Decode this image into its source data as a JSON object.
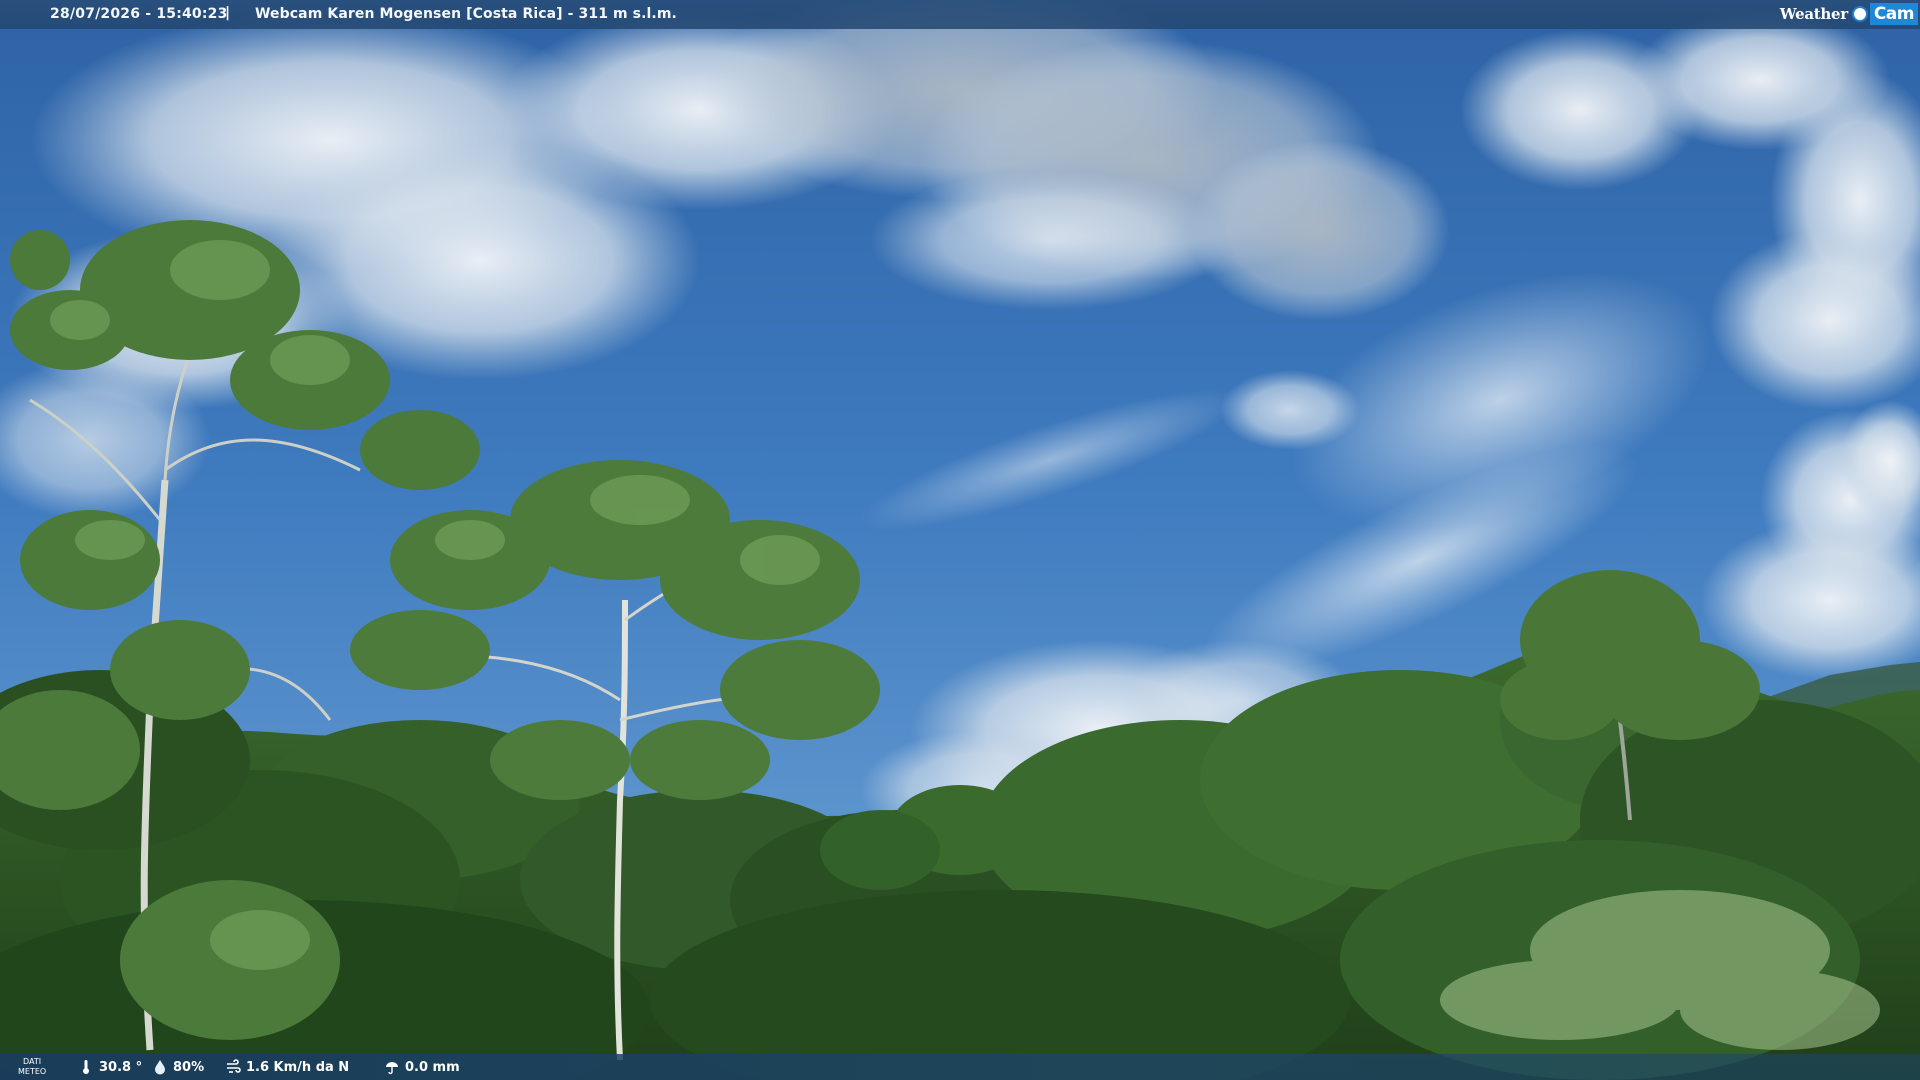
{
  "overlay": {
    "timestamp": "28/07/2026 - 15:40:23",
    "separator": "|",
    "camera_title": "Webcam Karen Mogensen [Costa Rica]  - 311 m s.l.m.",
    "logo_weather": "Weather",
    "logo_cam": "Cam"
  },
  "meteo": {
    "label_line1": "DATI",
    "label_line2": "METEO",
    "temperature": "30.8 °",
    "humidity": "80%",
    "wind": "1.6 Km/h da N",
    "rain": "0.0 mm"
  },
  "icons": {
    "temperature": "thermometer-icon",
    "humidity": "droplet-icon",
    "wind": "wind-icon",
    "rain": "rain-icon"
  },
  "colors": {
    "sky_top": "#3b73b6",
    "sky_bottom": "#5a94cf",
    "forest": "#2f5a26",
    "bar": "#23466e",
    "logo_blue": "#1e88d8"
  }
}
